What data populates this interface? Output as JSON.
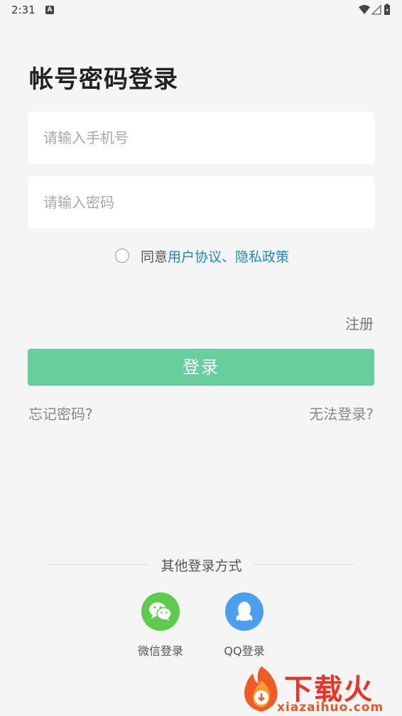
{
  "status_bar": {
    "time": "2:31",
    "notification_icon_letter": "A",
    "icons": [
      "a-notification-icon",
      "wifi-icon",
      "signal-icon",
      "battery-icon"
    ]
  },
  "page": {
    "title": "帐号密码登录"
  },
  "form": {
    "phone_placeholder": "请输入手机号",
    "phone_value": "",
    "password_placeholder": "请输入密码",
    "password_value": ""
  },
  "agreement": {
    "checked": false,
    "prefix": "同意",
    "user_agreement": "用户协议",
    "separator": "、",
    "privacy_policy": "隐私政策"
  },
  "actions": {
    "register": "注册",
    "login": "登录",
    "forgot_password": "忘记密码?",
    "cannot_login": "无法登录?"
  },
  "other_login": {
    "title": "其他登录方式",
    "options": [
      {
        "label": "微信登录",
        "icon": "wechat-icon",
        "color": "#5dcc4c"
      },
      {
        "label": "QQ登录",
        "icon": "qq-icon",
        "color": "#4b9ff0"
      }
    ]
  },
  "watermark": {
    "text": "下载火",
    "domain": "xiazaihuo.com"
  },
  "colors": {
    "accent": "#66cf9b",
    "link": "#1e88c7",
    "background": "#f5f5f5"
  }
}
